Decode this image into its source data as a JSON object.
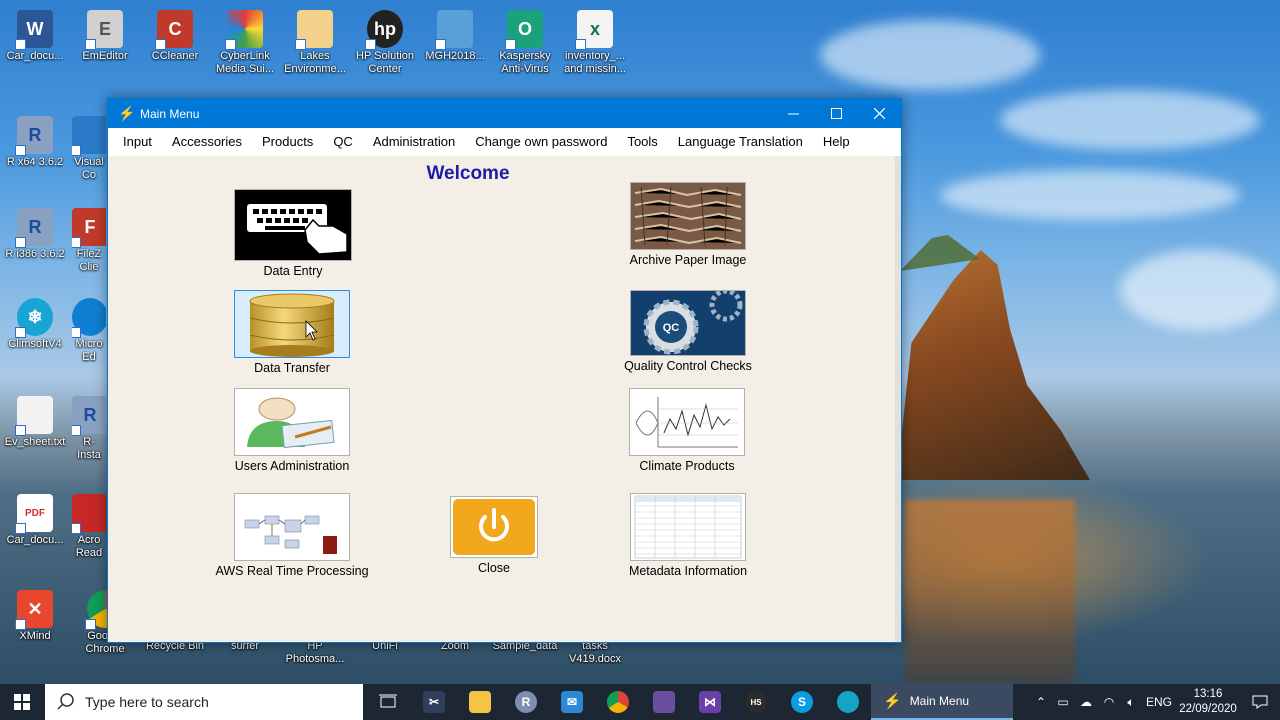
{
  "desktop": {
    "icons": [
      {
        "label": "Car_docu...",
        "badge": "W",
        "color": "#2b5797"
      },
      {
        "label": "EmEditor",
        "badge": "E",
        "color": "#d0d0d0"
      },
      {
        "label": "CCleaner",
        "badge": "C",
        "color": "#c0392b"
      },
      {
        "label": "CyberLink Media Sui...",
        "badge": "",
        "color": "#2e2e2e"
      },
      {
        "label": "Lakes Environme...",
        "badge": "",
        "color": "#f2d28a"
      },
      {
        "label": "HP Solution Center",
        "badge": "hp",
        "color": "#222"
      },
      {
        "label": "MGH2018...",
        "badge": "",
        "color": "#5aa0d8"
      },
      {
        "label": "Kaspersky Anti-Virus",
        "badge": "O",
        "color": "#1aa37a"
      },
      {
        "label": "inventory_... and missin...",
        "badge": "x",
        "color": "#1e7145"
      },
      {
        "label": "R x64 3.6.2",
        "badge": "R",
        "color": "#8aa0c0"
      },
      {
        "label": "Visual Co",
        "badge": "",
        "color": "#2c79c7"
      },
      {
        "label": "R i386 3.6.2",
        "badge": "R",
        "color": "#8aa0c0"
      },
      {
        "label": "FileZ Clie",
        "badge": "F",
        "color": "#c0392b"
      },
      {
        "label": "ClimsoftV4",
        "badge": "❄",
        "color": "#18a5d6"
      },
      {
        "label": "Micro Ed",
        "badge": "",
        "color": "#0f7fd3"
      },
      {
        "label": "Ev_sheet.txt",
        "badge": "",
        "color": "#f2f2f2"
      },
      {
        "label": "R-Insta",
        "badge": "R",
        "color": "#8aa0c0"
      },
      {
        "label": "Car_docu...",
        "badge": "PDF",
        "color": "#d32f2f"
      },
      {
        "label": "Acro Read",
        "badge": "",
        "color": "#c62828"
      },
      {
        "label": "XMind",
        "badge": "✕",
        "color": "#e8472d"
      },
      {
        "label": "Google Chrome",
        "badge": "",
        "color": "#3d9c48"
      },
      {
        "label": "Recycle Bin",
        "badge": "",
        "color": "transparent"
      },
      {
        "label": "surfer",
        "badge": "",
        "color": "transparent"
      },
      {
        "label": "HP Photosma...",
        "badge": "",
        "color": "transparent"
      },
      {
        "label": "UniFi",
        "badge": "",
        "color": "transparent"
      },
      {
        "label": "Zoom",
        "badge": "",
        "color": "transparent"
      },
      {
        "label": "Sample_data",
        "badge": "",
        "color": "transparent"
      },
      {
        "label": "tasks V419.docx",
        "badge": "",
        "color": "transparent"
      }
    ]
  },
  "window": {
    "title": "Main Menu",
    "menu": [
      "Input",
      "Accessories",
      "Products",
      "QC",
      "Administration",
      "Change own password",
      "Tools",
      "Language Translation",
      "Help"
    ],
    "welcome": "Welcome",
    "tiles": {
      "data_entry": "Data Entry",
      "data_transfer": "Data Transfer",
      "users_admin": "Users Administration",
      "aws": "AWS Real Time Processing",
      "close": "Close",
      "archive": "Archive Paper Image",
      "qc": "Quality Control Checks",
      "qc_badge": "QC",
      "climate": "Climate Products",
      "metadata": "Metadata Information"
    }
  },
  "taskbar": {
    "search_placeholder": "Type here to search",
    "active_app": "Main Menu",
    "language": "ENG",
    "time": "13:16",
    "date": "22/09/2020",
    "colors": {
      "bar": "#1d2633",
      "accent": "#0078d7"
    }
  }
}
